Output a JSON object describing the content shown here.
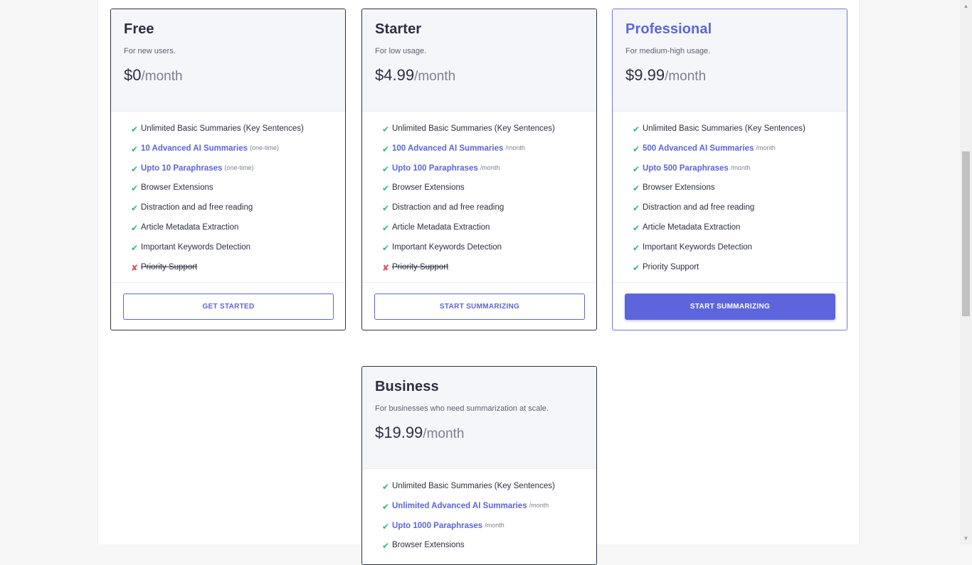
{
  "plans": [
    {
      "name": "Free",
      "desc": "For new users.",
      "price": "$0",
      "unit": "/month",
      "features": [
        {
          "text": "Unlimited Basic Summaries (Key Sentences)",
          "note": "",
          "mark": "✔",
          "status": "check"
        },
        {
          "text": "10 Advanced AI Summaries",
          "note": "(one-time)",
          "mark": "✔",
          "status": "highlight"
        },
        {
          "text": "Upto 10 Paraphrases",
          "note": "(one-time)",
          "mark": "✔",
          "status": "highlight"
        },
        {
          "text": "Browser Extensions",
          "note": "",
          "mark": "✔",
          "status": "check"
        },
        {
          "text": "Distraction and ad free reading",
          "note": "",
          "mark": "✔",
          "status": "check"
        },
        {
          "text": "Article Metadata Extraction",
          "note": "",
          "mark": "✔",
          "status": "check"
        },
        {
          "text": "Important Keywords Detection",
          "note": "",
          "mark": "✔",
          "status": "check"
        },
        {
          "text": "Priority Support",
          "note": "",
          "mark": "✘",
          "status": "cross"
        }
      ],
      "button": "GET STARTED",
      "primary": false
    },
    {
      "name": "Starter",
      "desc": "For low usage.",
      "price": "$4.99",
      "unit": "/month",
      "features": [
        {
          "text": "Unlimited Basic Summaries (Key Sentences)",
          "note": "",
          "mark": "✔",
          "status": "check"
        },
        {
          "text": "100 Advanced AI Summaries",
          "note": "/month",
          "mark": "✔",
          "status": "highlight"
        },
        {
          "text": "Upto 100 Paraphrases",
          "note": "/month",
          "mark": "✔",
          "status": "highlight"
        },
        {
          "text": "Browser Extensions",
          "note": "",
          "mark": "✔",
          "status": "check"
        },
        {
          "text": "Distraction and ad free reading",
          "note": "",
          "mark": "✔",
          "status": "check"
        },
        {
          "text": "Article Metadata Extraction",
          "note": "",
          "mark": "✔",
          "status": "check"
        },
        {
          "text": "Important Keywords Detection",
          "note": "",
          "mark": "✔",
          "status": "check"
        },
        {
          "text": "Priority Support",
          "note": "",
          "mark": "✘",
          "status": "cross"
        }
      ],
      "button": "START SUMMARIZING",
      "primary": false
    },
    {
      "name": "Professional",
      "desc": "For medium-high usage.",
      "price": "$9.99",
      "unit": "/month",
      "features": [
        {
          "text": "Unlimited Basic Summaries (Key Sentences)",
          "note": "",
          "mark": "✔",
          "status": "check"
        },
        {
          "text": "500 Advanced AI Summaries",
          "note": "/month",
          "mark": "✔",
          "status": "highlight"
        },
        {
          "text": "Upto 500 Paraphrases",
          "note": "/month",
          "mark": "✔",
          "status": "highlight"
        },
        {
          "text": "Browser Extensions",
          "note": "",
          "mark": "✔",
          "status": "check"
        },
        {
          "text": "Distraction and ad free reading",
          "note": "",
          "mark": "✔",
          "status": "check"
        },
        {
          "text": "Article Metadata Extraction",
          "note": "",
          "mark": "✔",
          "status": "check"
        },
        {
          "text": "Important Keywords Detection",
          "note": "",
          "mark": "✔",
          "status": "check"
        },
        {
          "text": "Priority Support",
          "note": "",
          "mark": "✔",
          "status": "check"
        }
      ],
      "button": "START SUMMARIZING",
      "primary": true
    },
    {
      "name": "Business",
      "desc": "For businesses who need summarization at scale.",
      "price": "$19.99",
      "unit": "/month",
      "features": [
        {
          "text": "Unlimited Basic Summaries (Key Sentences)",
          "note": "",
          "mark": "✔",
          "status": "check"
        },
        {
          "text": "Unlimited Advanced AI Summaries",
          "note": "/month",
          "mark": "✔",
          "status": "highlight"
        },
        {
          "text": "Upto 1000 Paraphrases",
          "note": "/month",
          "mark": "✔",
          "status": "highlight"
        },
        {
          "text": "Browser Extensions",
          "note": "",
          "mark": "✔",
          "status": "check"
        }
      ],
      "button": "",
      "primary": false
    }
  ],
  "colors": {
    "accent": "#5c65dc",
    "check": "#36b37e",
    "cross": "#e5485a",
    "card_header": "#f4f6fa"
  },
  "icons": {
    "check": "check-icon",
    "cross": "cross-icon",
    "scroll_up": "arrow-up-icon",
    "scroll_down": "arrow-down-icon"
  }
}
